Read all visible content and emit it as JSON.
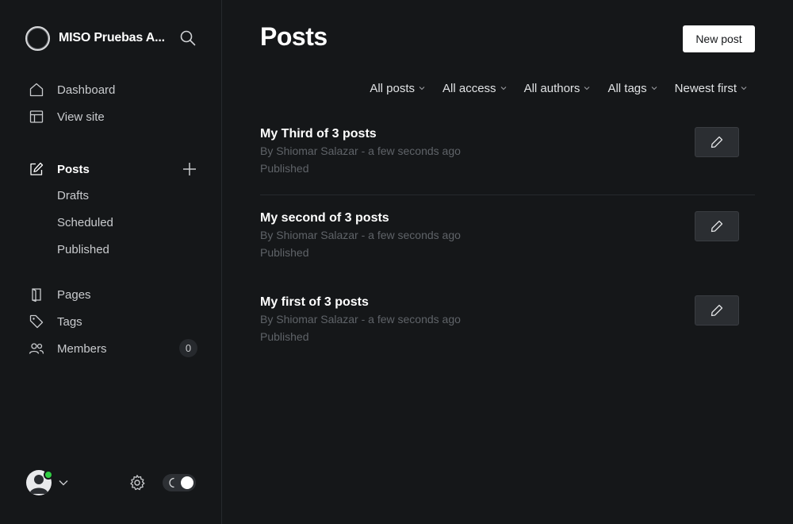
{
  "sidebar": {
    "site_name": "MISO Pruebas A...",
    "nav": {
      "dashboard": "Dashboard",
      "view_site": "View site",
      "posts": "Posts",
      "drafts": "Drafts",
      "scheduled": "Scheduled",
      "published": "Published",
      "pages": "Pages",
      "tags": "Tags",
      "members": "Members",
      "members_count": "0"
    }
  },
  "main": {
    "title": "Posts",
    "new_post_label": "New post",
    "filters": [
      "All posts",
      "All access",
      "All authors",
      "All tags",
      "Newest first"
    ],
    "posts": [
      {
        "title": "My Third of 3 posts",
        "meta": "By Shiomar Salazar - a few seconds ago",
        "status": "Published"
      },
      {
        "title": "My second of 3 posts",
        "meta": "By Shiomar Salazar - a few seconds ago",
        "status": "Published"
      },
      {
        "title": "My first of 3 posts",
        "meta": "By Shiomar Salazar - a few seconds ago",
        "status": "Published"
      }
    ]
  },
  "colors": {
    "background": "#151719",
    "online_indicator": "#30cf43",
    "primary_button": "#ffffff",
    "muted_text": "#5f6368"
  },
  "icons": [
    "search-icon",
    "home-icon",
    "layout-icon",
    "edit-icon",
    "plus-icon",
    "page-icon",
    "tag-icon",
    "members-icon",
    "settings-icon",
    "moon-icon",
    "chevron-down-icon",
    "pencil-icon"
  ]
}
